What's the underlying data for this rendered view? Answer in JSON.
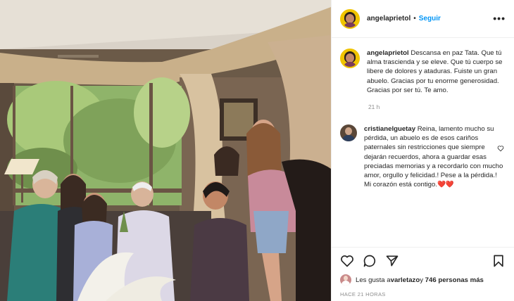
{
  "post": {
    "username": "angelaprietol",
    "dot": "•",
    "follow_label": "Seguir",
    "more_icon": "more-options-icon"
  },
  "caption": {
    "username": "angelaprietol",
    "text": "Descansa en paz Tata. Que tú alma trascienda y se eleve. Que tú cuerpo se libere de dolores y ataduras. Fuiste un gran abuelo. Gracias por tu enorme generosidad. Gracias por ser tú. Te amo.",
    "time": "21 h"
  },
  "comment": {
    "username": "cristianelguetay",
    "text": "Reina, lamento mucho su pérdida, un abuelo es de esos cariños paternales sin restricciones que siempre dejarán recuerdos, ahora a guardar esas preciadas memorias y a recordarlo con mucho amor, orgullo y felicidad.! Pese a la pérdida.!",
    "text2": "Mi corazón está contigo.❤️❤️"
  },
  "likes": {
    "prefix": "Les gusta a ",
    "user": "varletazo",
    "middle": " y ",
    "count": "746 personas más"
  },
  "timestamp": "HACE 21 HORAS",
  "colors": {
    "link": "#0095f6",
    "muted": "#8e8e8e",
    "border": "#efefef",
    "avatar_ring": "#f0c400"
  }
}
